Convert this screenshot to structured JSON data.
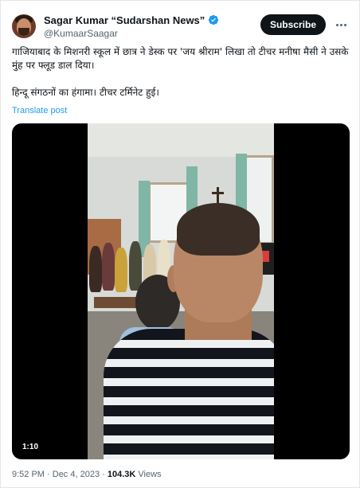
{
  "author": {
    "display_name": "Sagar Kumar “Sudarshan News”",
    "handle": "@KumaarSaagar",
    "verified_icon": "verified-badge-icon",
    "avatar_icon": "avatar"
  },
  "header": {
    "subscribe_label": "Subscribe",
    "more_icon": "more-options-icon"
  },
  "tweet": {
    "paragraph_1": "गाजियाबाद के मिशनरी स्कूल में छात्र ने डेस्क पर 'जय श्रीराम' लिखा तो टीचर मनीषा मैसी ने उसके मुंह पर फ्लूड डाल दिया।",
    "paragraph_2": "हिन्दू संगठनों का हंगामा। टीचर टर्मिनेट हुई।",
    "translate_label": "Translate post"
  },
  "video": {
    "duration": "1:10"
  },
  "meta": {
    "time": "9:52 PM",
    "separator": " · ",
    "date": "Dec 4, 2023",
    "views_count": "104.3K",
    "views_label": "Views"
  },
  "colors": {
    "accent": "#1d9bf0",
    "text": "#0f1419",
    "muted": "#536471"
  }
}
